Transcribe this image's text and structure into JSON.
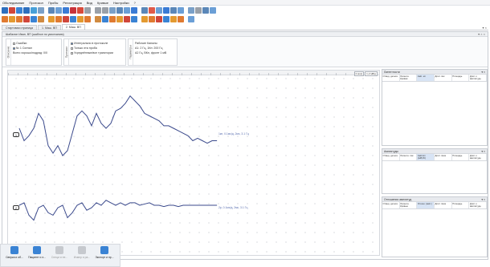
{
  "menu": [
    "Обследование",
    "Протокол",
    "Пробы",
    "Регистрация",
    "Вид",
    "Кривые",
    "Настройки",
    "?"
  ],
  "toolbar_colors": {
    "row1": [
      "#2e6fbe",
      "#d0463b",
      "#3a83d4",
      "#2e6fbe",
      "#48a0d8",
      "#7aa0c8",
      "#5b87b8",
      "#6b9fd6",
      "#3a7bd5",
      "#c8323a",
      "#d84a3a",
      "#9aa0a8",
      "#9aa0a8",
      "#9aa0a8",
      "#7aa0c8",
      "#5b87b8",
      "#6b9fd6",
      "#3a7bd5",
      "#5b87b8",
      "#e05a4a",
      "#6b9fd6",
      "#3a7bd5",
      "#5b87b8",
      "#6b9fd6",
      "#7aa0c8",
      "#9aa0a8",
      "#5b87b8",
      "#6b9fd6"
    ],
    "row2": [
      "#e07a30",
      "#e39a30",
      "#e07a30",
      "#d0463b",
      "#3a83d4",
      "#d08a40",
      "#e39a30",
      "#e07a30",
      "#d0463b",
      "#3a83d4",
      "#e39a30",
      "#e07a30",
      "#d08a40",
      "#3a83d4",
      "#e07a30",
      "#e39a30",
      "#d0463b",
      "#3a83d4",
      "#e39a30",
      "#e07a30",
      "#d0463b",
      "#3a83d4",
      "#e39a30",
      "#e07a30",
      "#6b9fd6"
    ]
  },
  "tabs": [
    {
      "label": "Стартовая страница",
      "active": false
    },
    {
      "label": "1. Маш. ВП",
      "active": false
    },
    {
      "label": "2. Маш. ВП",
      "active": true
    }
  ],
  "window": {
    "title": "Шабалин Иван, ВП (шаблон по умолчанию)",
    "controls": "▾ × ×"
  },
  "params": {
    "group1": {
      "label": "Описание",
      "items": [
        "Ошибки",
        "№ 1 Сигнал",
        "Всего хорошо/подряд: 0/0"
      ]
    },
    "group2": {
      "label": "Протокол",
      "items": [
        "Интегрально в протоколе",
        "Только эта проба",
        "Усреднённые/все траектории"
      ]
    },
    "group3": {
      "label": "Параметры",
      "items": [
        "Рабочие Каналы",
        "А1: 2 Гц, 1Кп: 200 Гц",
        "А2 Гц, ВКп, фронт 1 мВ"
      ]
    }
  },
  "chart": {
    "scale": [
      "2 мс/д",
      "1-2 мВ/д"
    ],
    "channel_markers": [
      "1",
      "2"
    ],
    "trace1_label": "1кп, 0.1мс/д, 2мс, 3.1 Гц",
    "trace2_label": "2p, 0.1мс/д, 2мс, 3.1 Гц"
  },
  "chart_data": {
    "type": "line",
    "series": [
      {
        "name": "",
        "values": [
          0,
          -10,
          -6,
          0,
          12,
          6,
          -14,
          -20,
          -14,
          -22,
          -18,
          -4,
          10,
          14,
          10,
          2,
          12,
          4,
          0,
          4,
          14,
          16,
          20,
          26,
          22,
          18,
          12,
          10,
          8,
          6,
          2,
          2,
          0,
          -2,
          -4,
          -6,
          -10,
          -8,
          -10,
          -12,
          -10,
          -10
        ]
      },
      {
        "name": "",
        "values": [
          0,
          2,
          -8,
          -12,
          -2,
          0,
          -6,
          -8,
          -2,
          0,
          -10,
          -6,
          0,
          2,
          -4,
          -2,
          2,
          0,
          4,
          2,
          0,
          2,
          0,
          2,
          2,
          0,
          1,
          2,
          0,
          0,
          -1,
          0,
          0,
          -1,
          0,
          0,
          0,
          0,
          0,
          0,
          0,
          0
        ]
      }
    ]
  },
  "right_panels": [
    {
      "title": "Латентности",
      "controls": "▾ ×",
      "columns": [
        "Отвед. дельта",
        "Латентн. Кривая",
        "Амп. нп",
        "Длит. пик",
        "Площадь",
        "Длит. к амплитуде"
      ],
      "selected": 2
    },
    {
      "title": "Амплитуды",
      "controls": "▾ ×",
      "columns": [
        "Отвед. дельта",
        "Латентн. пик",
        "Амплит. (пкB,Ю)",
        "Длит. пика",
        "Площадь",
        "Длит. к амплитуде"
      ],
      "selected": 2
    },
    {
      "title": "Отношения амплитуд",
      "controls": "▾ ×",
      "columns": [
        "Отвед. дельта",
        "Латентн. Кривые",
        "Отнош. (амп.)",
        "Длит. пика",
        "Площадь",
        "Длит. к амплитуде"
      ],
      "selected": 2
    }
  ],
  "statusbar": [
    {
      "label": "Сверка и об...",
      "badge": "",
      "color": "#3a83d4",
      "dim": false
    },
    {
      "label": "Пациент и э...",
      "badge": "Пл",
      "color": "#3a83d4",
      "dim": false
    },
    {
      "label": "Специ и пе...",
      "badge": "",
      "color": "#c6c9ce",
      "dim": true
    },
    {
      "label": "Измер и ра...",
      "badge": "",
      "color": "#c6c9ce",
      "dim": true
    },
    {
      "label": "Экспорт и пр...",
      "badge": "",
      "color": "#3a83d4",
      "dim": false
    }
  ]
}
